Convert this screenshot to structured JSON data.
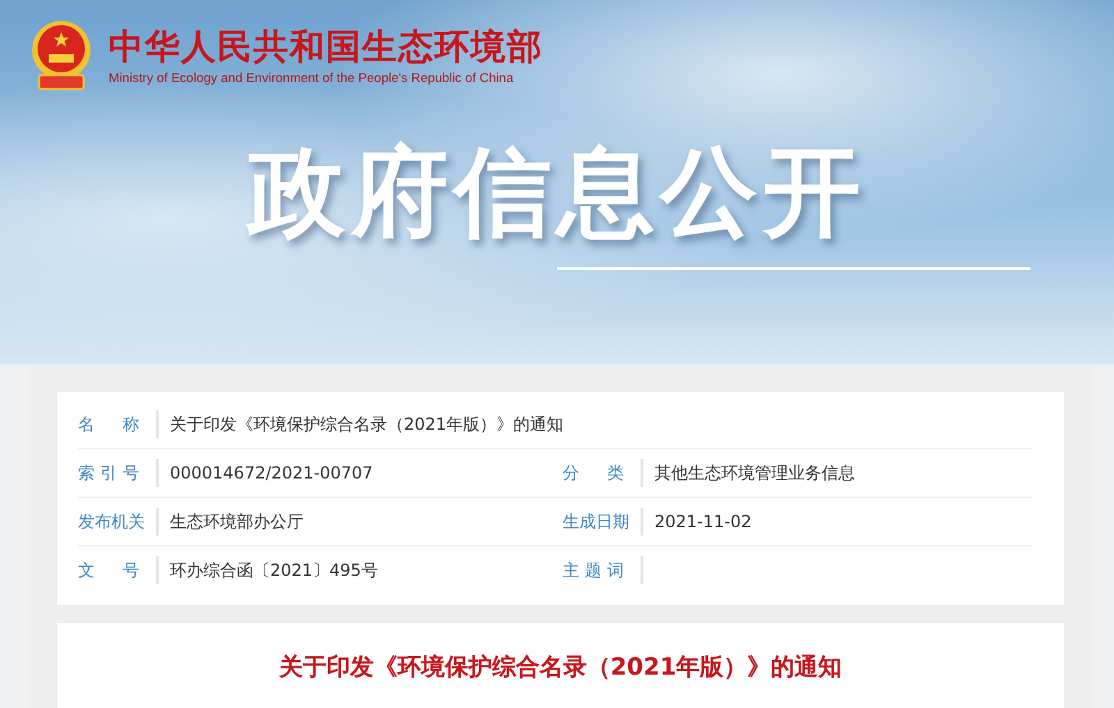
{
  "header": {
    "title_cn": "中华人民共和国生态环境部",
    "title_en": "Ministry of Ecology and Environment of the People's Republic of China",
    "banner": "政府信息公开"
  },
  "meta_rows": [
    {
      "fields": [
        {
          "label": "名 称",
          "value": "关于印发《环境保护综合名录（2021年版）》的通知"
        }
      ]
    },
    {
      "fields": [
        {
          "label": "索 引 号",
          "value": "000014672/2021-00707"
        },
        {
          "label": "分 类",
          "value": "其他生态环境管理业务信息"
        }
      ]
    },
    {
      "fields": [
        {
          "label": "发布机关",
          "value": "生态环境部办公厅"
        },
        {
          "label": "生成日期",
          "value": "2021-11-02"
        }
      ]
    },
    {
      "fields": [
        {
          "label": "文 号",
          "value": "环办综合函〔2021〕495号"
        },
        {
          "label": "主 题 词"
        }
      ]
    }
  ],
  "article": {
    "title": "关于印发《环境保护综合名录（2021年版）》的通知"
  }
}
